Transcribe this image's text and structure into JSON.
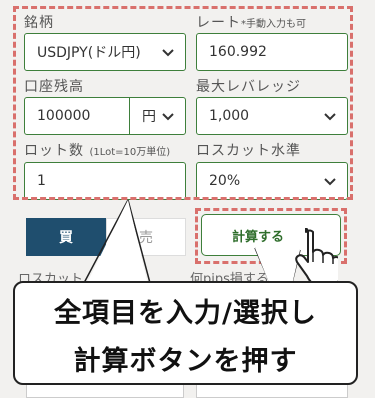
{
  "form": {
    "symbol_label": "銘柄",
    "symbol_value": "USDJPY(ドル円)",
    "rate_label": "レート",
    "rate_note": "*手動入力も可",
    "rate_value": "160.992",
    "balance_label": "口座残高",
    "balance_value": "100000",
    "balance_unit": "円",
    "leverage_label": "最大レバレッジ",
    "leverage_value": "1,000",
    "lot_label": "ロット数",
    "lot_note": "(1Lot=10万単位)",
    "lot_value": "1",
    "losscut_label": "ロスカット水準",
    "losscut_value": "20%"
  },
  "actions": {
    "buy_label": "買",
    "sell_label": "売",
    "calculate_label": "計算する"
  },
  "partial_labels": {
    "left": "ロスカット",
    "right": "何pips損する"
  },
  "callout": {
    "line1": "全項目を入力/選択し",
    "line2": "計算ボタンを押す"
  },
  "colors": {
    "field_border": "#3e7f3b",
    "buy_bg": "#1f4e6e",
    "highlight_dash": "#d9706c"
  }
}
